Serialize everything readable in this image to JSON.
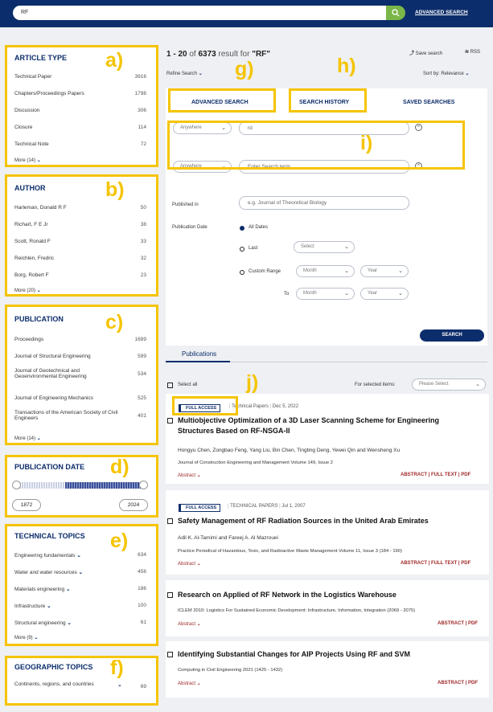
{
  "header": {
    "search_value": "RF",
    "advanced_search": "ADVANCED SEARCH"
  },
  "callouts": {
    "a": "a)",
    "b": "b)",
    "c": "c)",
    "d": "d)",
    "e": "e)",
    "f": "f)",
    "g": "g)",
    "h": "h)",
    "i": "i)",
    "j": "j)"
  },
  "article_type": {
    "title": "ARTICLE TYPE",
    "items": [
      {
        "label": "Technical Paper",
        "count": "3916"
      },
      {
        "label": "Chapters/Proceedings Papers",
        "count": "1798"
      },
      {
        "label": "Discussion",
        "count": "306"
      },
      {
        "label": "Closure",
        "count": "114"
      },
      {
        "label": "Technical Note",
        "count": "72"
      }
    ],
    "more": "More (14)"
  },
  "author": {
    "title": "AUTHOR",
    "items": [
      {
        "label": "Harleman, Donald R F",
        "count": "50"
      },
      {
        "label": "Richart, F E Jr",
        "count": "38"
      },
      {
        "label": "Scott, Ronald F",
        "count": "33"
      },
      {
        "label": "Reichlen, Fredric",
        "count": "32"
      },
      {
        "label": "Borg, Robert F",
        "count": "23"
      }
    ],
    "more": "More (20)"
  },
  "publication": {
    "title": "PUBLICATION",
    "items": [
      {
        "label": "Proceedings",
        "count": "1699"
      },
      {
        "label": "Journal of Structural Engineering",
        "count": "599"
      },
      {
        "label": "Journal of Geotechnical and Geoenvironmental Engineering",
        "count": "534"
      },
      {
        "label": "Journal of Engineering Mechanics",
        "count": "525"
      },
      {
        "label": "Transactions of the American Society of Civil Engineers",
        "count": "401"
      }
    ],
    "more": "More (14)"
  },
  "publication_date": {
    "title": "PUBLICATION DATE",
    "from": "1872",
    "to": "2024"
  },
  "technical_topics": {
    "title": "TECHNICAL TOPICS",
    "items": [
      {
        "label": "Engineering fundamentals",
        "count": "634"
      },
      {
        "label": "Water and water resources",
        "count": "456"
      },
      {
        "label": "Materials engineering",
        "count": "186"
      },
      {
        "label": "Infrastructure",
        "count": "100"
      },
      {
        "label": "Structural engineering",
        "count": "61"
      }
    ],
    "more": "More (9)"
  },
  "geographic_topics": {
    "title": "GEOGRAPHIC TOPICS",
    "items": [
      {
        "label": "Continents, regions, and countries",
        "count": "69"
      }
    ]
  },
  "results": {
    "range": "1 - 20",
    "of": "of",
    "total": "6373",
    "result_for": "result for",
    "query": "\"RF\"",
    "save_search": "Save search",
    "rss": "RSS",
    "refine": "Refine Search",
    "sort": "Sort by: Relevance"
  },
  "tabs": {
    "advanced": "ADVANCED SEARCH",
    "history": "SEARCH HISTORY",
    "saved": "SAVED SEARCHES"
  },
  "form": {
    "field1_select": "Anywhere",
    "field1_value": "rd",
    "field2_select": "Anywhere",
    "field2_placeholder": "Enter Search term",
    "published_in_label": "Published in",
    "published_in_placeholder": "e.g. Journal of Theoretical Biology",
    "pub_date_label": "Publication Date",
    "all_dates": "All Dates",
    "last": "Last",
    "select": "Select",
    "custom_range": "Custom Range",
    "month": "Month",
    "year": "Year",
    "to": "To",
    "search_btn": "SEARCH"
  },
  "list": {
    "publications_tab": "Publications",
    "select_all": "Select all",
    "for_selected": "For selected items:",
    "please_select": "Please Select"
  },
  "articles": [
    {
      "badge": "FULL ACCESS",
      "type": "Technical Papers",
      "date": "Dec 5, 2022",
      "title": "Multiobjective Optimization of a 3D Laser Scanning Scheme for Engineering Structures Based on RF-NSGA-II",
      "authors": "Hongyu Chen, Zongbao Feng, Yang Liu, Bin Chen, Tingting Deng, Yewei Qin and Wensheng Xu",
      "journal": "Journal of Construction Engineering and Management  Volume 149, Issue 2",
      "abstract": "Abstract",
      "links": "ABSTRACT | FULL TEXT | PDF"
    },
    {
      "badge": "FULL ACCESS",
      "type": "TECHNICAL PAPERS",
      "date": "Jul 1, 2007",
      "title": "Safety Management of RF Radiation Sources in the United Arab Emirates",
      "authors": "Adil K. Al-Tamimi and Fareej A. Al Mazrouei",
      "journal": "Practice Periodical of Hazardous, Toxic, and Radioactive Waste Management  Volume 11, Issue 3 (184 - 190)",
      "abstract": "Abstract",
      "links": "ABSTRACT | FULL TEXT | PDF"
    },
    {
      "title": "Research on Applied of RF Network in the Logistics Warehouse",
      "journal": "ICLEM 2010: Logistics For Sustained Economic Development: Infrastructure, Information, Integration  (2069 - 2075)",
      "abstract": "Abstract",
      "links": "ABSTRACT | PDF"
    },
    {
      "title": "Identifying Substantial Changes for AIP Projects Using RF and SVM",
      "journal": "Computing in Civil Engineering 2021  (1425 - 1432)",
      "abstract": "Abstract",
      "links": "ABSTRACT | PDF"
    }
  ]
}
